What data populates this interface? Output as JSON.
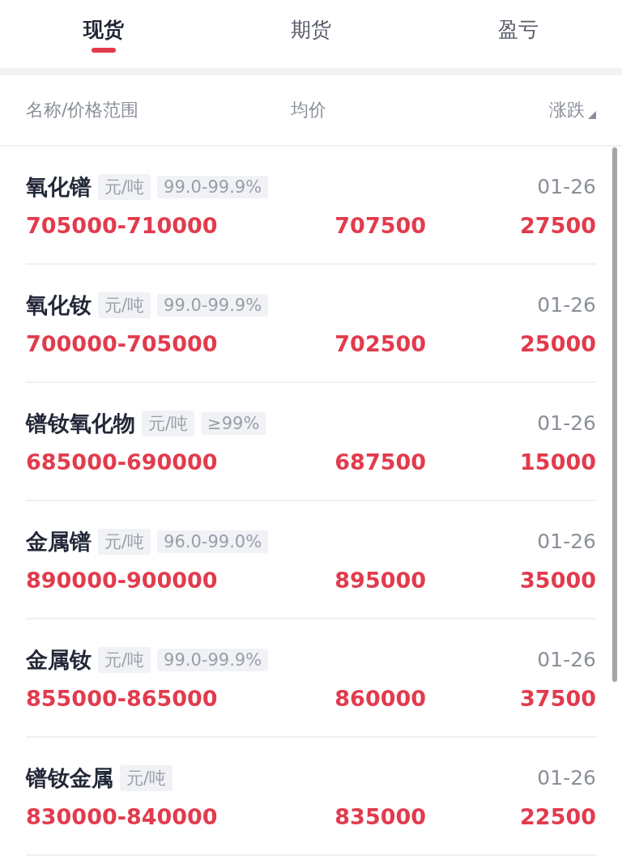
{
  "tabs": [
    {
      "label": "现货",
      "selected": true
    },
    {
      "label": "期货",
      "selected": false
    },
    {
      "label": "盈亏",
      "selected": false
    }
  ],
  "table": {
    "columns": [
      "名称/价格范围",
      "均价",
      "涨跌"
    ],
    "sorted": true,
    "rows": [
      {
        "name": "氧化镨",
        "unit": "元/吨",
        "purity": "99.0-99.9%",
        "date": "01-26",
        "range": "705000-710000",
        "average": "707500",
        "change": "27500"
      },
      {
        "name": "氧化钕",
        "unit": "元/吨",
        "purity": "99.0-99.9%",
        "date": "01-26",
        "range": "700000-705000",
        "average": "702500",
        "change": "25000"
      },
      {
        "name": "镨钕氧化物",
        "unit": "元/吨",
        "purity": "≥99%",
        "date": "01-26",
        "range": "685000-690000",
        "average": "687500",
        "change": "15000"
      },
      {
        "name": "金属镨",
        "unit": "元/吨",
        "purity": "96.0-99.0%",
        "date": "01-26",
        "range": "890000-900000",
        "average": "895000",
        "change": "35000"
      },
      {
        "name": "金属钕",
        "unit": "元/吨",
        "purity": "99.0-99.9%",
        "date": "01-26",
        "range": "855000-865000",
        "average": "860000",
        "change": "37500"
      },
      {
        "name": "镨钕金属",
        "unit": "元/吨",
        "date": "01-26",
        "range": "830000-840000",
        "average": "835000",
        "change": "22500"
      }
    ]
  }
}
